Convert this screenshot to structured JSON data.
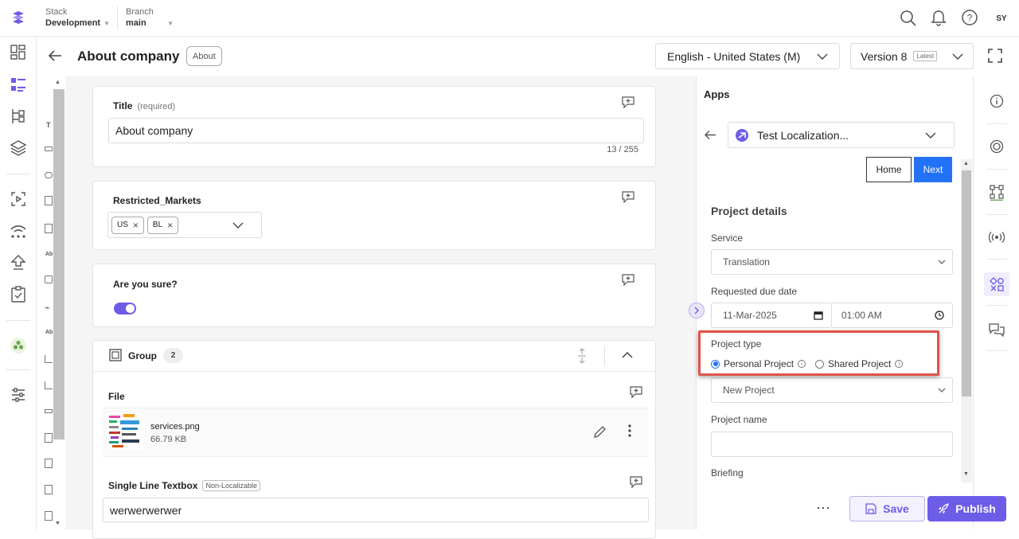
{
  "topbar": {
    "stack_label": "Stack",
    "stack_value": "Development",
    "branch_label": "Branch",
    "branch_value": "main",
    "avatar": "SY"
  },
  "header": {
    "title": "About company",
    "badge": "About",
    "language": "English - United States (M)",
    "version": "Version 8",
    "version_badge": "Latest"
  },
  "fields": {
    "title_label": "Title",
    "title_required": "(required)",
    "title_value": "About company",
    "title_count": "13 / 255",
    "restricted_label": "Restricted_Markets",
    "tags": [
      "US",
      "BL"
    ],
    "sure_label": "Are you sure?",
    "group_label": "Group",
    "group_count": "2",
    "file_label": "File",
    "file_name": "services.png",
    "file_size": "66.79 KB",
    "single_line_label": "Single Line Textbox",
    "single_line_badge": "Non-Localizable",
    "single_line_value": "werwerwerwer"
  },
  "tool_labels": [
    "T",
    "Ab",
    "Ab"
  ],
  "apps": {
    "title": "Apps",
    "selected_app": "Test Localization...",
    "home_btn": "Home",
    "next_btn": "Next",
    "section_title": "Project details",
    "service_label": "Service",
    "service_value": "Translation",
    "due_label": "Requested due date",
    "due_date": "11-Mar-2025",
    "due_time": "01:00 AM",
    "project_type_label": "Project type",
    "personal_project": "Personal Project",
    "shared_project": "Shared Project",
    "new_project": "New Project",
    "project_name_label": "Project name",
    "project_name_value": "",
    "briefing_label": "Briefing"
  },
  "footer": {
    "more": "⋯",
    "save": "Save",
    "publish": "Publish"
  },
  "colors": {
    "accent": "#6c5ce7",
    "blue": "#2372f5",
    "highlight": "#e0534a"
  }
}
